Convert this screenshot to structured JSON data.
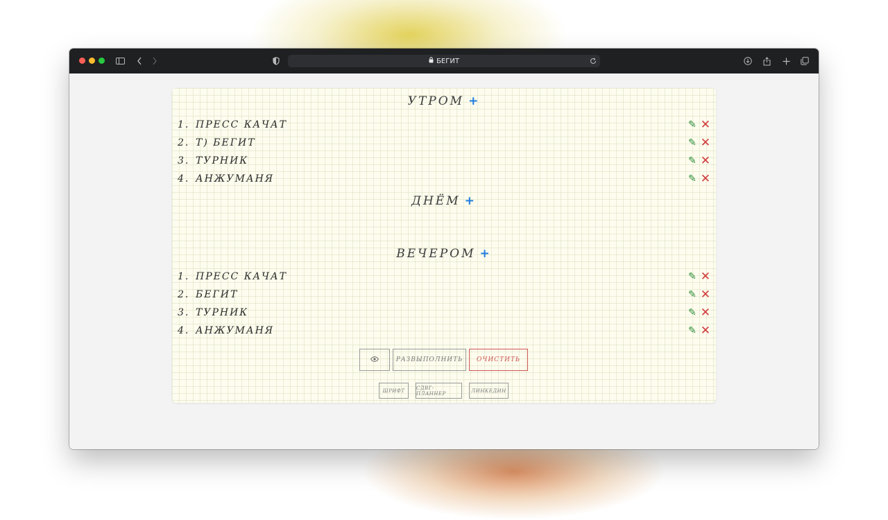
{
  "browser": {
    "address": "БЕГИТ"
  },
  "sections": {
    "morning": {
      "title": "УТРОМ",
      "items": [
        {
          "num": "1.",
          "text": "ПРЕСС КАЧАТ"
        },
        {
          "num": "2.",
          "text": "Т) БЕГИТ"
        },
        {
          "num": "3.",
          "text": "ТУРНИК"
        },
        {
          "num": "4.",
          "text": "АНЖУМАНЯ"
        }
      ]
    },
    "day": {
      "title": "ДНЁМ"
    },
    "evening": {
      "title": "ВЕЧЕРОМ",
      "items": [
        {
          "num": "1.",
          "text": "ПРЕСС КАЧАТ"
        },
        {
          "num": "2.",
          "text": "БЕГИТ"
        },
        {
          "num": "3.",
          "text": "ТУРНИК"
        },
        {
          "num": "4.",
          "text": "АНЖУМАНЯ"
        }
      ]
    }
  },
  "buttons": {
    "uncomplete": "РАЗВЫПОЛНИТЬ",
    "clear": "ОЧИСТИТЬ"
  },
  "footer": {
    "font": "ШРИФТ",
    "planner": "СДВГ-ПЛАННЕР",
    "linkedin": "ЛИНКЕДИН"
  },
  "icons": {
    "plus": "+",
    "edit": "✎",
    "delete": "✕",
    "eye": "👁"
  },
  "colors": {
    "accent_blue": "#1e7be0",
    "edit_green": "#2f8f3a",
    "delete_red": "#d23b3b",
    "paper": "#fdfcee"
  }
}
